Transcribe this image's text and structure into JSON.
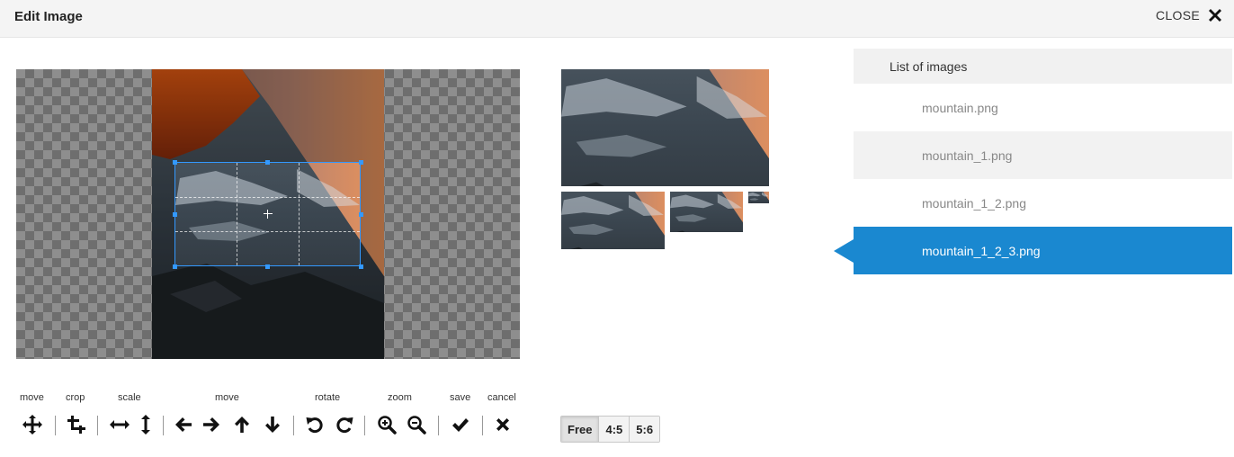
{
  "header": {
    "title": "Edit Image",
    "close_label": "CLOSE"
  },
  "toolbar": {
    "labels": {
      "move": "move",
      "crop": "crop",
      "scale": "scale",
      "move2": "move",
      "rotate": "rotate",
      "zoom": "zoom",
      "save": "save",
      "cancel": "cancel"
    },
    "icons": [
      "move-icon",
      "crop-icon",
      "scale-horizontal-icon",
      "scale-vertical-icon",
      "arrow-left-icon",
      "arrow-right-icon",
      "arrow-up-icon",
      "arrow-down-icon",
      "rotate-left-icon",
      "rotate-right-icon",
      "zoom-in-icon",
      "zoom-out-icon",
      "check-icon",
      "cancel-icon"
    ]
  },
  "aspect_ratios": {
    "options": [
      "Free",
      "4:5",
      "5:6"
    ],
    "selected": "Free"
  },
  "image_list": {
    "header": "List of images",
    "items": [
      {
        "name": "mountain.png"
      },
      {
        "name": "mountain_1.png"
      },
      {
        "name": "mountain_1_2.png"
      },
      {
        "name": "mountain_1_2_3.png"
      }
    ],
    "selected": "mountain_1_2_3.png"
  },
  "colors": {
    "accent": "#1a88d0",
    "crop_border": "#3399ff",
    "header_bg": "#f4f4f4"
  }
}
